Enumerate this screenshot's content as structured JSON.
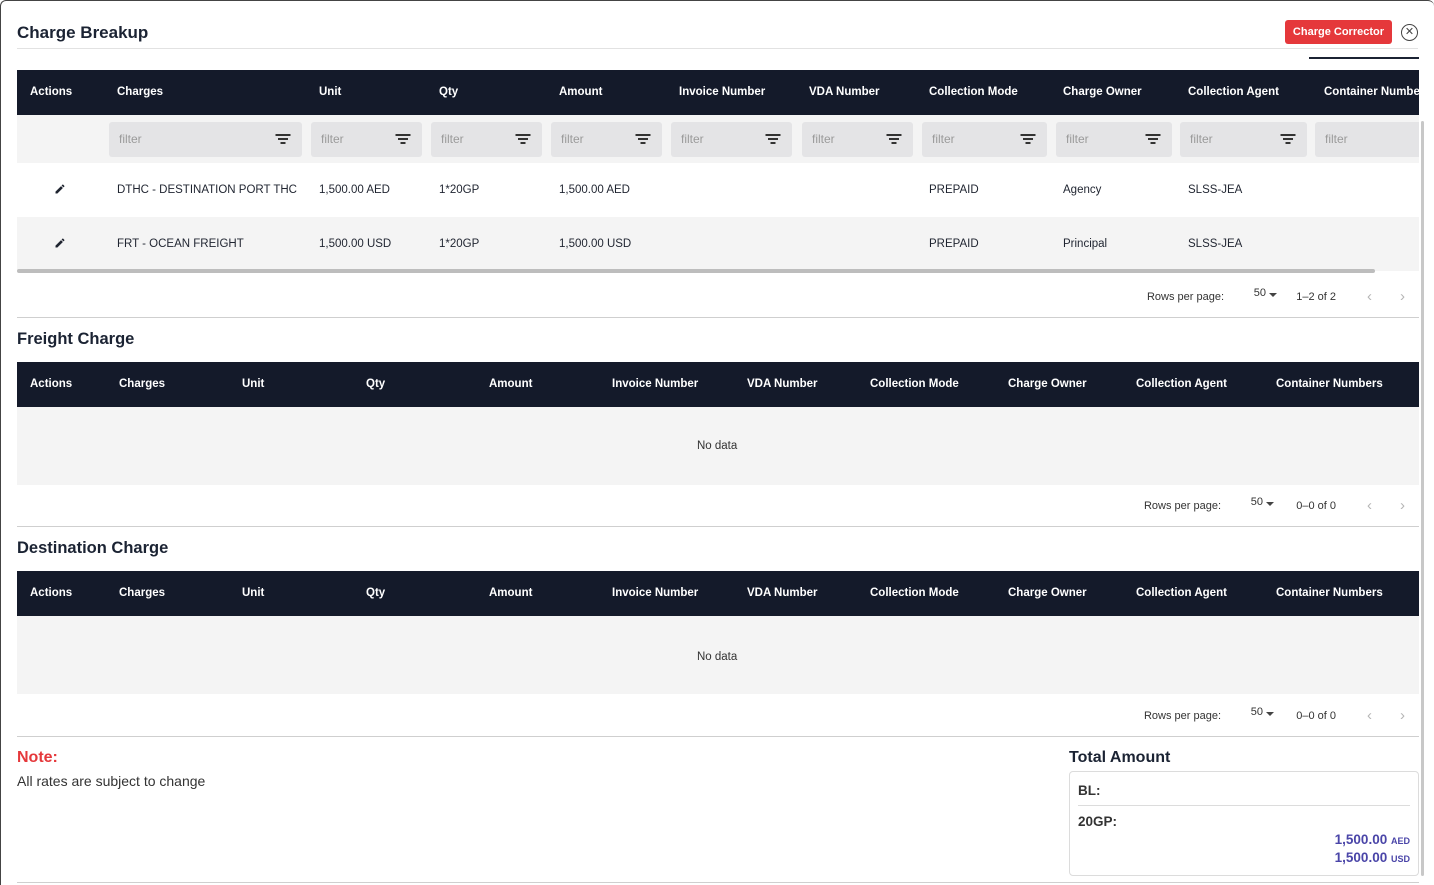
{
  "header": {
    "title": "Charge Breakup",
    "corrector_label": "Charge Corrector",
    "close_glyph": "✕"
  },
  "columns_main": [
    "Actions",
    "Charges",
    "Unit",
    "Qty",
    "Amount",
    "Invoice Number",
    "VDA Number",
    "Collection Mode",
    "Charge Owner",
    "Collection Agent",
    "Container Numbe"
  ],
  "columns_full": [
    "Actions",
    "Charges",
    "Unit",
    "Qty",
    "Amount",
    "Invoice Number",
    "VDA Number",
    "Collection Mode",
    "Charge Owner",
    "Collection Agent",
    "Container Numbers"
  ],
  "filter_placeholder": "filter",
  "rows": [
    {
      "charge": "DTHC - DESTINATION PORT THC",
      "unit": "1,500.00 AED",
      "qty": "1*20GP",
      "amount": "1,500.00 AED",
      "collection_mode": "PREPAID",
      "charge_owner": "Agency",
      "collection_agent": "SLSS-JEA"
    },
    {
      "charge": "FRT - OCEAN FREIGHT",
      "unit": "1,500.00 USD",
      "qty": "1*20GP",
      "amount": "1,500.00 USD",
      "collection_mode": "PREPAID",
      "charge_owner": "Principal",
      "collection_agent": "SLSS-JEA"
    }
  ],
  "pager_main": {
    "rows_per_page_label": "Rows per page:",
    "rows_per_page": "50",
    "count": "1–2 of 2",
    "prev": "‹",
    "next": "›"
  },
  "freight": {
    "title": "Freight Charge",
    "no_data": "No data",
    "pager": {
      "rows_per_page_label": "Rows per page:",
      "rows_per_page": "50",
      "count": "0–0 of 0",
      "prev": "‹",
      "next": "›"
    }
  },
  "destination": {
    "title": "Destination Charge",
    "no_data": "No data",
    "pager": {
      "rows_per_page_label": "Rows per page:",
      "rows_per_page": "50",
      "count": "0–0 of 0",
      "prev": "‹",
      "next": "›"
    }
  },
  "note": {
    "label": "Note:",
    "text": "All rates are subject to change"
  },
  "total": {
    "title": "Total Amount",
    "bl_label": "BL:",
    "container_label": "20GP:",
    "amounts": [
      {
        "value": "1,500.00",
        "currency": "AED"
      },
      {
        "value": "1,500.00",
        "currency": "USD"
      }
    ]
  },
  "colors": {
    "header_bg": "#141a2a",
    "accent_red": "#e5383b",
    "amount_purple": "#4a45a8"
  }
}
